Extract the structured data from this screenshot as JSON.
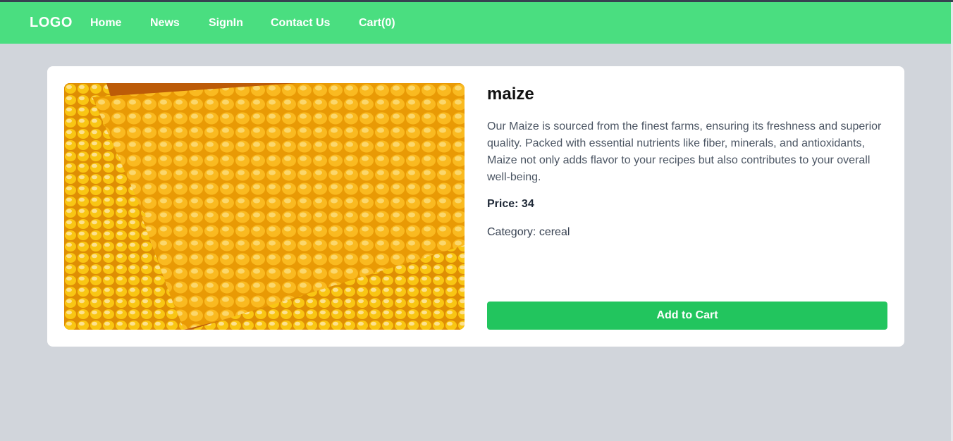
{
  "navbar": {
    "logo": "LOGO",
    "links": [
      "Home",
      "News",
      "SignIn",
      "Contact Us",
      "Cart(0)"
    ],
    "color": "#4ade80"
  },
  "product": {
    "name": "maize",
    "description": "Our Maize is sourced from the finest farms, ensuring its freshness and superior quality. Packed with essential nutrients like fiber, minerals, and antioxidants, Maize not only adds flavor to your recipes but also contributes to your overall well-being.",
    "price_label": "Price:",
    "price": "34",
    "category_label": "Category:",
    "category": "cereal",
    "image_subject": "corn-cobs-photo"
  },
  "actions": {
    "add_to_cart": "Add to Cart",
    "button_color": "#22c55e"
  }
}
